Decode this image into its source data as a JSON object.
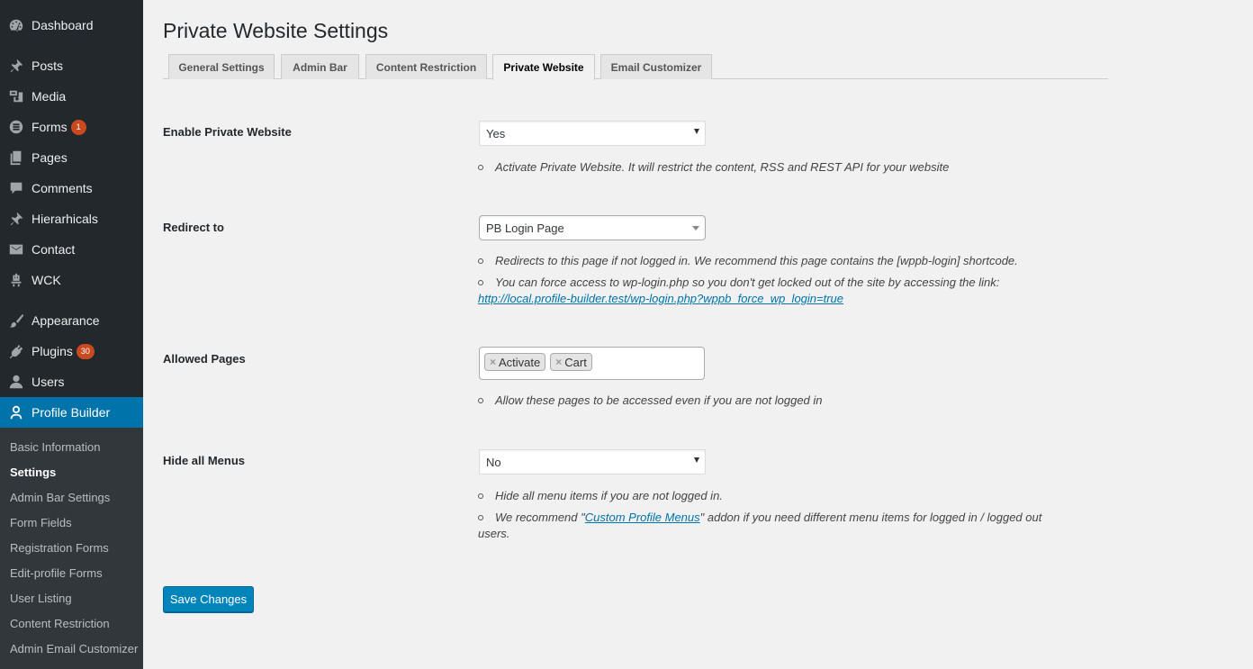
{
  "sidebar": {
    "items": [
      {
        "label": "Dashboard",
        "icon": "dashboard-icon"
      },
      {
        "label": "Posts",
        "icon": "pin-icon"
      },
      {
        "label": "Media",
        "icon": "media-icon"
      },
      {
        "label": "Forms",
        "icon": "forms-icon",
        "badge": "1"
      },
      {
        "label": "Pages",
        "icon": "pages-icon"
      },
      {
        "label": "Comments",
        "icon": "comment-icon"
      },
      {
        "label": "Hierarhicals",
        "icon": "pin-icon"
      },
      {
        "label": "Contact",
        "icon": "mail-icon"
      },
      {
        "label": "WCK",
        "icon": "robot-icon"
      },
      {
        "label": "Appearance",
        "icon": "brush-icon"
      },
      {
        "label": "Plugins",
        "icon": "plugin-icon",
        "badge": "30"
      },
      {
        "label": "Users",
        "icon": "user-icon"
      },
      {
        "label": "Profile Builder",
        "icon": "profile-icon"
      }
    ],
    "submenu": [
      "Basic Information",
      "Settings",
      "Admin Bar Settings",
      "Form Fields",
      "Registration Forms",
      "Edit-profile Forms",
      "User Listing",
      "Content Restriction",
      "Admin Email Customizer"
    ]
  },
  "page": {
    "title": "Private Website Settings",
    "tabs": [
      "General Settings",
      "Admin Bar",
      "Content Restriction",
      "Private Website",
      "Email Customizer"
    ],
    "active_tab": "Private Website"
  },
  "settings": {
    "enable": {
      "label": "Enable Private Website",
      "value": "Yes",
      "desc": "Activate Private Website. It will restrict the content, RSS and REST API for your website"
    },
    "redirect": {
      "label": "Redirect to",
      "value": "PB Login Page",
      "desc1": "Redirects to this page if not logged in. We recommend this page contains the [wppb-login] shortcode.",
      "desc2": "You can force access to wp-login.php so you don't get locked out of the site by accessing the link:",
      "link": "http://local.profile-builder.test/wp-login.php?wppb_force_wp_login=true"
    },
    "allowed": {
      "label": "Allowed Pages",
      "chips": [
        "Activate",
        "Cart"
      ],
      "remove_symbol": "×",
      "desc": "Allow these pages to be accessed even if you are not logged in"
    },
    "menus": {
      "label": "Hide all Menus",
      "value": "No",
      "desc1": "Hide all menu items if you are not logged in.",
      "desc2_pre": "We recommend \"",
      "desc2_link": "Custom Profile Menus",
      "desc2_post": "\" addon if you need different menu items for logged in / logged out",
      "desc2_wrap": "users."
    }
  },
  "save_label": "Save Changes",
  "colors": {
    "sidebar_bg": "#23282d",
    "submenu_bg": "#32373c",
    "accent": "#0073aa",
    "badge": "#ca4a1f",
    "button": "#0085ba"
  }
}
